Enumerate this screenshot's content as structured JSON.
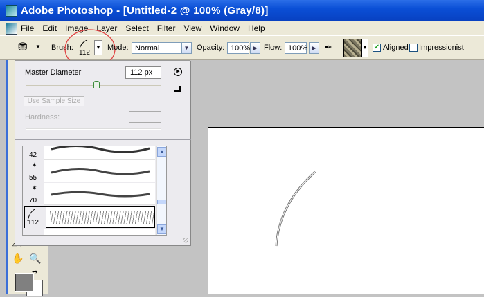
{
  "window": {
    "title": "Adobe Photoshop - [Untitled-2 @ 100% (Gray/8)]"
  },
  "menu": [
    "File",
    "Edit",
    "Image",
    "Layer",
    "Select",
    "Filter",
    "View",
    "Window",
    "Help"
  ],
  "options": {
    "brush_label": "Brush:",
    "brush_size": "112",
    "mode_label": "Mode:",
    "mode_value": "Normal",
    "opacity_label": "Opacity:",
    "opacity_value": "100%",
    "flow_label": "Flow:",
    "flow_value": "100%",
    "aligned_label": "Aligned",
    "aligned_checked": true,
    "impressionist_label": "Impressionist",
    "impressionist_checked": false
  },
  "brush_popup": {
    "master_diameter_label": "Master Diameter",
    "master_diameter_value": "112 px",
    "master_diameter_slider_percent": 50,
    "use_sample_size_label": "Use Sample Size",
    "hardness_label": "Hardness:",
    "hardness_value": "",
    "brushes": [
      {
        "size": "42"
      },
      {
        "size": "55"
      },
      {
        "size": "70"
      },
      {
        "size": "112",
        "selected": true
      },
      {
        "size": ""
      }
    ]
  },
  "colors": {
    "highlight_circle": "#e04040",
    "titlebar": "#0a4fd6",
    "foreground": "#808080"
  }
}
